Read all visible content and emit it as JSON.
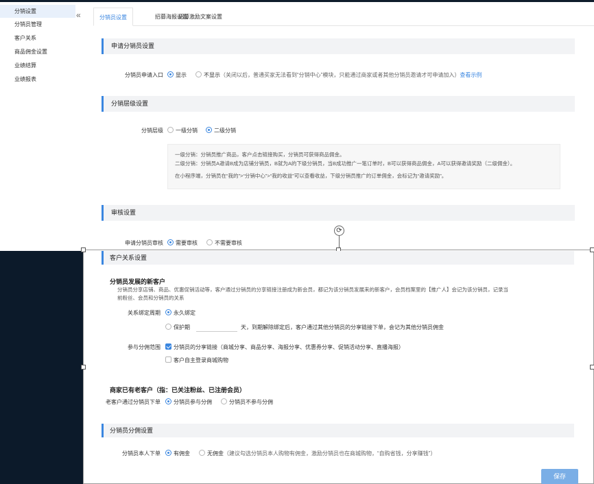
{
  "sidebar": {
    "collapse_icon": "«",
    "items": [
      {
        "label": "分销设置",
        "active": true
      },
      {
        "label": "分销员管理",
        "active": false
      },
      {
        "label": "客户关系",
        "active": false
      },
      {
        "label": "商品佣金设置",
        "active": false
      },
      {
        "label": "业绩结算",
        "active": false
      },
      {
        "label": "业绩报表",
        "active": false
      }
    ]
  },
  "tabs": [
    {
      "label": "分销员设置",
      "active": true
    },
    {
      "label": "招募海报设置",
      "active": false
    },
    {
      "label": "招募激励文案设置",
      "active": false
    }
  ],
  "apply_section": {
    "title": "申请分销员设置",
    "row_label": "分销员申请入口",
    "opt_show": "显示",
    "opt_hide": "不显示",
    "hide_note": "（关闭以后，普通买家无法看到“分销中心”模块，只能通过商家或者其他分销员邀请才可申请加入）",
    "view_example": "查看示例"
  },
  "level_section": {
    "title": "分销层级设置",
    "row_label": "分销层级",
    "opt_one": "一级分销",
    "opt_two": "二级分销",
    "desc_line1": "一级分销：分销员推广商品，客户点击链接购买，分销员可获得商品佣金。",
    "desc_line2": "二级分销：分销员A邀请B成为店铺分销员，B就为A的下级分销员，当B成功推广一笔订单时，B可以获得商品佣金，A可以获得邀请奖励（二级佣金）。",
    "desc_line3": "在小程序端，分销员在“我的”>“分销中心”>“我的收益”可以查看收益，下级分销员推广的订单佣金，会标记为“邀请奖励”。"
  },
  "review_section": {
    "title": "审核设置",
    "row_label": "申请分销员审核",
    "opt_need": "需要审核",
    "opt_no_need": "不需要审核"
  },
  "customer_section": {
    "title": "客户关系设置",
    "new_customer_title": "分销员发展的新客户",
    "new_customer_desc1": "分销员分享店铺、商品、优惠促销活动等，客户通过分销员的分享链接注册成为新会员，都记为该分销员发展来的新客户，会员档案里的【推广人】会记为该分销员，记录当",
    "new_customer_desc2": "前粉丝、会员和分销员的关系",
    "bind_label": "关系绑定周期",
    "bind_forever": "永久绑定",
    "bind_protect": "保护期",
    "bind_protect_value": "",
    "bind_protect_note": "天，到期解除绑定后，客户通过其他分销员的分享链接下单，会记为其他分销员佣金",
    "scope_label": "参与分佣范围",
    "scope_share": "分销员的分享链接（商城分享、商品分享、海报分享、优惠券分享、促销活动分享、直播海报）",
    "scope_self": "客户自主登录商城购物",
    "old_customer_title": "商家已有老客户（指：已关注粉丝、已注册会员）",
    "old_label": "老客户通过分销员下单",
    "old_join": "分销员参与分佣",
    "old_not_join": "分销员不参与分佣"
  },
  "commission_section": {
    "title": "分销员分佣设置",
    "self_label": "分销员本人下单",
    "opt_yes": "有佣金",
    "opt_no": "无佣金",
    "note": "（建议勾选分销员本人购物有佣金，激励分销员也在商城购物，“自购省钱，分享赚钱”）"
  },
  "save_label": "保存",
  "rotate_icon": "⟳",
  "colors": {
    "accent": "#3a86e0",
    "dark": "#0c1a2a"
  }
}
